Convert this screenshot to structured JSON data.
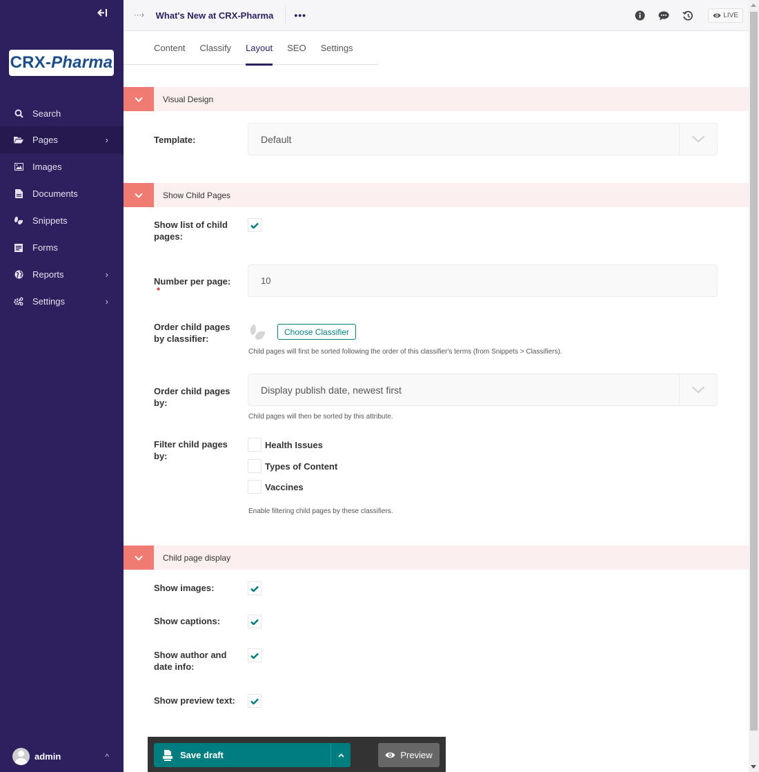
{
  "sidebar": {
    "logo_text_a": "CRX-",
    "logo_text_b": "Pharma",
    "collapse_icon": "arrow-left-bar-icon",
    "items": [
      {
        "label": "Search",
        "icon": "search-icon",
        "has_submenu": false
      },
      {
        "label": "Pages",
        "icon": "folder-open-icon",
        "has_submenu": true,
        "active": true
      },
      {
        "label": "Images",
        "icon": "image-icon",
        "has_submenu": false
      },
      {
        "label": "Documents",
        "icon": "document-icon",
        "has_submenu": false
      },
      {
        "label": "Snippets",
        "icon": "snippet-leaf-icon",
        "has_submenu": false
      },
      {
        "label": "Forms",
        "icon": "form-icon",
        "has_submenu": false
      },
      {
        "label": "Reports",
        "icon": "globe-icon",
        "has_submenu": true
      },
      {
        "label": "Settings",
        "icon": "cogs-icon",
        "has_submenu": true
      }
    ],
    "user": {
      "name": "admin"
    }
  },
  "header": {
    "breadcrumb_icon": "···›",
    "title": "What's New at CRX-Pharma",
    "more_label": "•••",
    "icons": [
      "info-icon",
      "comment-icon",
      "history-icon"
    ],
    "live_label": "LIVE"
  },
  "tabs": [
    {
      "label": "Content",
      "active": false
    },
    {
      "label": "Classify",
      "active": false
    },
    {
      "label": "Layout",
      "active": true
    },
    {
      "label": "SEO",
      "active": false
    },
    {
      "label": "Settings",
      "active": false
    }
  ],
  "sections": {
    "visual_design": {
      "title": "Visual Design",
      "template_label": "Template:",
      "template_value": "Default"
    },
    "show_child_pages": {
      "title": "Show Child Pages",
      "show_list_label": "Show list of child pages:",
      "show_list_checked": true,
      "number_label": "Number per page:",
      "required_mark": "*",
      "number_value": "10",
      "order_classifier_label": "Order child pages by classifier:",
      "choose_classifier_label": "Choose Classifier",
      "order_classifier_help": "Child pages will first be sorted following the order of this classifier's terms (from Snippets > Classifiers).",
      "order_by_label": "Order child pages by:",
      "order_by_value": "Display publish date, newest first",
      "order_by_help": "Child pages will then be sorted by this attribute.",
      "filter_label": "Filter child pages by:",
      "filter_options": [
        {
          "label": "Health Issues",
          "checked": false
        },
        {
          "label": "Types of Content",
          "checked": false
        },
        {
          "label": "Vaccines",
          "checked": false
        }
      ],
      "filter_help": "Enable filtering child pages by these classifiers."
    },
    "child_page_display": {
      "title": "Child page display",
      "options": [
        {
          "label": "Show images:",
          "checked": true
        },
        {
          "label": "Show captions:",
          "checked": true
        },
        {
          "label": "Show author and date info:",
          "checked": true
        },
        {
          "label": "Show preview text:",
          "checked": true
        }
      ]
    }
  },
  "footer": {
    "save_label": "Save draft",
    "preview_label": "Preview"
  },
  "colors": {
    "sidebar_bg": "#2e1f5e",
    "accent_teal": "#007d7e",
    "section_toggle": "#f07b72",
    "section_bg": "#fcefef"
  }
}
